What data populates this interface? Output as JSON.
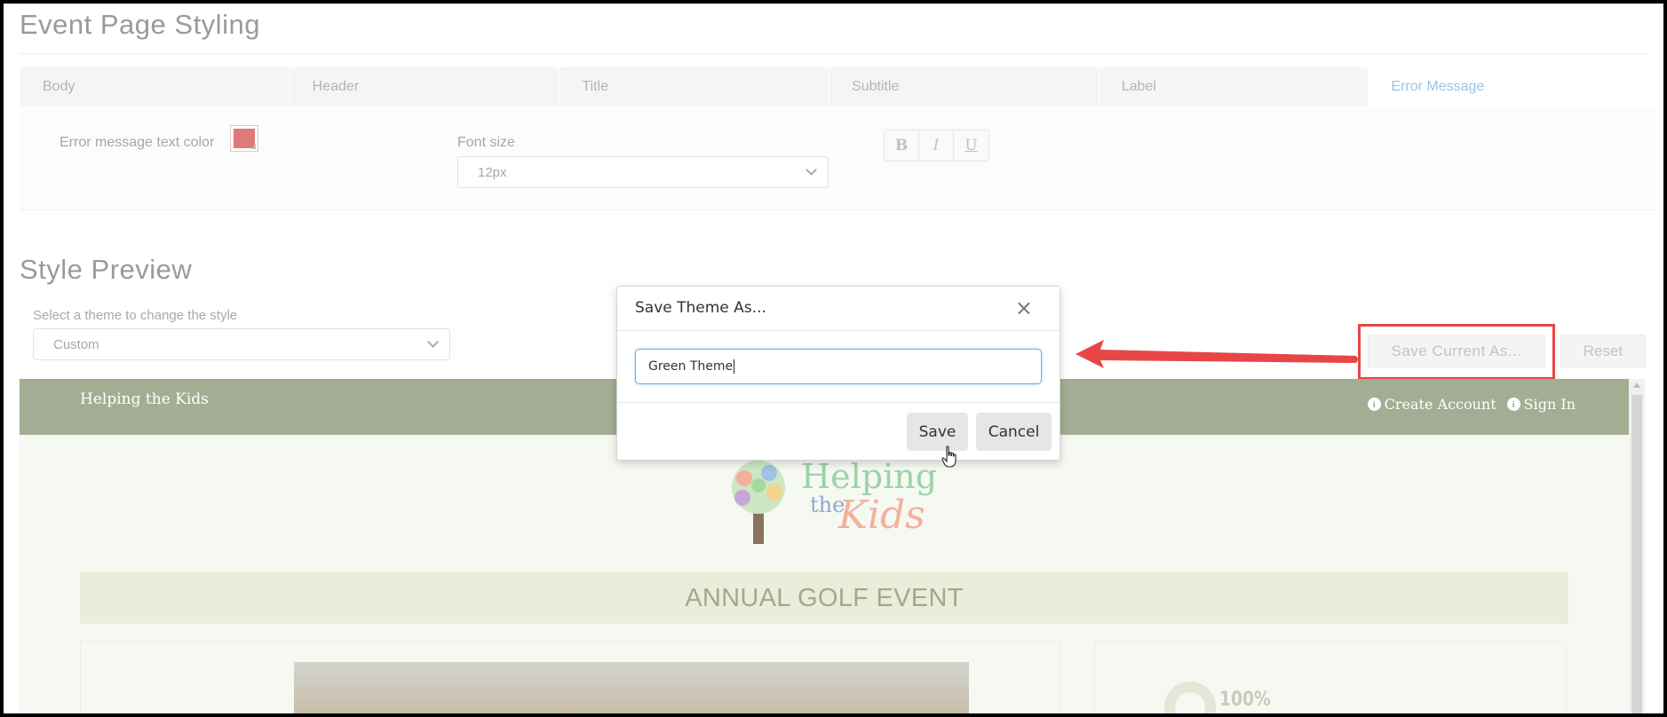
{
  "page": {
    "title": "Event Page Styling"
  },
  "tabs": [
    {
      "label": "Body",
      "active": false
    },
    {
      "label": "Header",
      "active": false
    },
    {
      "label": "Title",
      "active": false
    },
    {
      "label": "Subtitle",
      "active": false
    },
    {
      "label": "Label",
      "active": false
    },
    {
      "label": "Error Message",
      "active": true
    }
  ],
  "error_message_panel": {
    "text_color_label": "Error message text color",
    "text_color_value": "#de7a7a",
    "font_size_label": "Font size",
    "font_size_value": "12px",
    "format_buttons": [
      "B",
      "I",
      "U"
    ]
  },
  "style_preview": {
    "title": "Style Preview",
    "theme_label": "Select a theme to change the style",
    "theme_value": "Custom",
    "save_current_label": "Save Current As...",
    "reset_label": "Reset"
  },
  "preview": {
    "brand": "Helping the Kids",
    "nav": [
      "Create Account",
      "Sign In"
    ],
    "logo": {
      "line1": "Helping",
      "line2a": "the",
      "line2b": "Kids"
    },
    "event_title": "ANNUAL GOLF EVENT",
    "progress_text": "100%",
    "header_color": "#a3ad93"
  },
  "modal": {
    "title": "Save Theme As...",
    "close_symbol": "×",
    "input_value": "Green Theme",
    "save_label": "Save",
    "cancel_label": "Cancel"
  },
  "annotation": {
    "color": "#e84646"
  }
}
